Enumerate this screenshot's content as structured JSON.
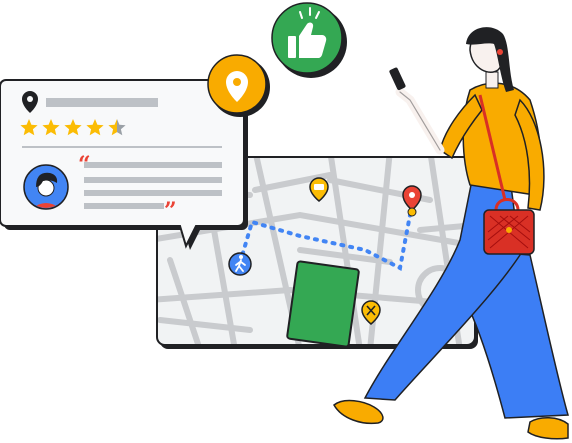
{
  "illustration": {
    "colors": {
      "map_land": "#f1f3f4",
      "map_streets": "#c9cbce",
      "route": "#4285f4",
      "park": "#34a853",
      "pin_red": "#ea4335",
      "badge_green": "#34a853",
      "badge_yellow": "#f9ab00",
      "star": "#fbbc04",
      "placeholder_line": "#bdc1c6",
      "pants_blue": "#3c7ef5",
      "shirt_yellow": "#f9ab00",
      "bag_red": "#d93025",
      "outline": "#202124"
    },
    "review_card": {
      "rating_stars": 4.5,
      "rating_max": 5,
      "icons": [
        "location-pin-icon",
        "star-icon",
        "quote-open-icon",
        "quote-close-icon"
      ]
    },
    "badges": [
      "location-pin-icon",
      "thumbs-up-icon"
    ],
    "map_markers": [
      "walking-person-icon",
      "restaurant-icon",
      "coffee-icon",
      "destination-pin-icon"
    ]
  }
}
